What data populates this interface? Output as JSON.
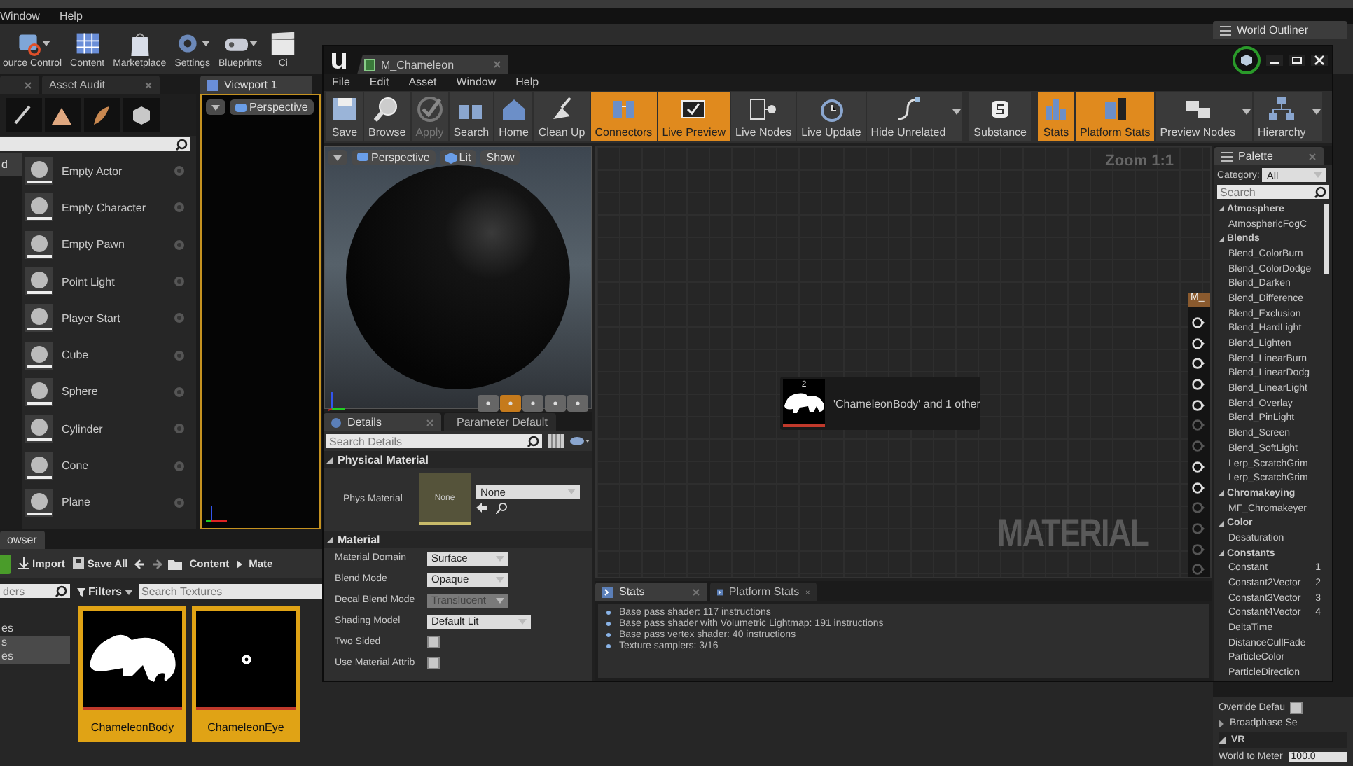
{
  "editor": {
    "menu": [
      "Window",
      "Help"
    ],
    "toolbar": [
      {
        "label": "ource Control",
        "dropdown": true
      },
      {
        "label": "Content",
        "dropdown": false
      },
      {
        "label": "Marketplace",
        "dropdown": false
      },
      {
        "label": "Settings",
        "dropdown": true
      },
      {
        "label": "Blueprints",
        "dropdown": true
      },
      {
        "label": "Ci",
        "dropdown": false
      }
    ],
    "modes": {
      "tabs": [
        {
          "label": "Asset Audit",
          "selected": false
        }
      ],
      "category": "d",
      "items": [
        "Empty Actor",
        "Empty Character",
        "Empty Pawn",
        "Point Light",
        "Player Start",
        "Cube",
        "Sphere",
        "Cylinder",
        "Cone",
        "Plane"
      ]
    },
    "viewport": {
      "tab": "Viewport 1",
      "view_mode": "Perspective"
    },
    "world_outliner": {
      "tab": "World Outliner"
    },
    "content_browser": {
      "tab": "owser",
      "actions": [
        "Import",
        "Save All"
      ],
      "path": [
        "Content",
        "Mate"
      ],
      "folder_search": {
        "placeholder": "ders"
      },
      "folders": [
        {
          "label": "es",
          "selected": false
        },
        {
          "label": "s",
          "selected": true
        },
        {
          "label": "es",
          "selected": true
        }
      ],
      "filters": "Filters",
      "asset_search": {
        "placeholder": "Search Textures"
      },
      "assets": [
        {
          "name": "ChameleonBody",
          "selected": true
        },
        {
          "name": "ChameleonEye",
          "selected": true
        }
      ]
    },
    "details": {
      "rows": [
        {
          "kind": "checkbox",
          "label": "Override Defau",
          "checked": false
        },
        {
          "kind": "group",
          "label": "Broadphase Se"
        }
      ],
      "section": "VR",
      "fields": [
        {
          "label": "World to Meter",
          "value": "100.0"
        }
      ]
    }
  },
  "material_editor": {
    "tab": "M_Chameleon",
    "menu": [
      "File",
      "Edit",
      "Asset",
      "Window",
      "Help"
    ],
    "toolbar": [
      {
        "label": "Save",
        "active": false,
        "disabled": false,
        "dropdown": false
      },
      {
        "label": "Browse",
        "active": false,
        "disabled": false,
        "dropdown": false
      },
      {
        "label": "Apply",
        "active": false,
        "disabled": true,
        "dropdown": false
      },
      {
        "label": "Search",
        "active": false,
        "disabled": false,
        "dropdown": false
      },
      {
        "label": "Home",
        "active": false,
        "disabled": false,
        "dropdown": false
      },
      {
        "label": "Clean Up",
        "active": false,
        "disabled": false,
        "dropdown": false
      },
      {
        "label": "Connectors",
        "active": true,
        "disabled": false,
        "dropdown": false
      },
      {
        "label": "Live Preview",
        "active": true,
        "disabled": false,
        "dropdown": false
      },
      {
        "label": "Live Nodes",
        "active": false,
        "disabled": false,
        "dropdown": false
      },
      {
        "label": "Live Update",
        "active": false,
        "disabled": false,
        "dropdown": false
      },
      {
        "label": "Hide Unrelated",
        "active": false,
        "disabled": false,
        "dropdown": true
      },
      {
        "label": "Substance",
        "active": false,
        "disabled": false,
        "dropdown": false
      },
      {
        "label": "Stats",
        "active": true,
        "disabled": false,
        "dropdown": false
      },
      {
        "label": "Platform Stats",
        "active": true,
        "disabled": false,
        "dropdown": false
      },
      {
        "label": "Preview Nodes",
        "active": false,
        "disabled": false,
        "dropdown": true
      },
      {
        "label": "Hierarchy",
        "active": false,
        "disabled": false,
        "dropdown": true
      }
    ],
    "viewport": {
      "buttons": [
        "Perspective",
        "Lit",
        "Show"
      ],
      "shapes": [
        {
          "selected": false
        },
        {
          "selected": true
        },
        {
          "selected": false
        },
        {
          "selected": false
        },
        {
          "selected": false
        }
      ]
    },
    "details": {
      "tabs": [
        {
          "label": "Details",
          "selected": true
        },
        {
          "label": "Parameter Default",
          "selected": false
        }
      ],
      "search": {
        "placeholder": "Search Details"
      },
      "sections": [
        {
          "title": "Physical Material",
          "expanded": true,
          "rows": [
            {
              "kind": "asset",
              "label": "Phys Material",
              "thumbnail": "None",
              "value": "None"
            }
          ]
        },
        {
          "title": "Material",
          "expanded": true,
          "rows": [
            {
              "kind": "combo",
              "label": "Material Domain",
              "value": "Surface",
              "disabled": false,
              "wide": false
            },
            {
              "kind": "combo",
              "label": "Blend Mode",
              "value": "Opaque",
              "disabled": false,
              "wide": false
            },
            {
              "kind": "combo",
              "label": "Decal Blend Mode",
              "value": "Translucent",
              "disabled": true,
              "wide": false
            },
            {
              "kind": "combo",
              "label": "Shading Model",
              "value": "Default Lit",
              "disabled": false,
              "wide": true
            },
            {
              "kind": "checkbox",
              "label": "Two Sided",
              "checked": false
            },
            {
              "kind": "checkbox",
              "label": "Use Material Attrib",
              "checked": false
            }
          ]
        }
      ]
    },
    "graph": {
      "zoom": "Zoom 1:1",
      "watermark": "MATERIAL",
      "texture_node": {
        "count": "2",
        "label": "'ChameleonBody' and 1 other"
      },
      "result_node": {
        "title": "M_",
        "pins": [
          {
            "enabled": true
          },
          {
            "enabled": true
          },
          {
            "enabled": true
          },
          {
            "enabled": true
          },
          {
            "enabled": true
          },
          {
            "enabled": false
          },
          {
            "enabled": false
          },
          {
            "enabled": true
          },
          {
            "enabled": true
          },
          {
            "enabled": false
          },
          {
            "enabled": false
          },
          {
            "enabled": false
          },
          {
            "enabled": false
          }
        ]
      }
    },
    "stats": {
      "tabs": [
        {
          "label": "Stats",
          "selected": true
        },
        {
          "label": "Platform Stats",
          "selected": false
        }
      ],
      "messages": [
        "Base pass shader: 117 instructions",
        "Base pass shader with Volumetric Lightmap: 191 instructions",
        "Base pass vertex shader: 40 instructions",
        "Texture samplers: 3/16"
      ]
    },
    "palette": {
      "tab": "Palette",
      "category_label": "Category:",
      "category": "All",
      "search": {
        "placeholder": "Search"
      },
      "groups": [
        {
          "title": "Atmosphere",
          "expanded": true,
          "children": [
            {
              "label": "AtmosphericFogC"
            }
          ]
        },
        {
          "title": "Blends",
          "expanded": true,
          "children": [
            {
              "label": "Blend_ColorBurn"
            },
            {
              "label": "Blend_ColorDodge"
            },
            {
              "label": "Blend_Darken"
            },
            {
              "label": "Blend_Difference"
            },
            {
              "label": "Blend_Exclusion"
            },
            {
              "label": "Blend_HardLight"
            },
            {
              "label": "Blend_Lighten"
            },
            {
              "label": "Blend_LinearBurn"
            },
            {
              "label": "Blend_LinearDodg"
            },
            {
              "label": "Blend_LinearLight"
            },
            {
              "label": "Blend_Overlay"
            },
            {
              "label": "Blend_PinLight"
            },
            {
              "label": "Blend_Screen"
            },
            {
              "label": "Blend_SoftLight"
            },
            {
              "label": "Lerp_ScratchGrim"
            },
            {
              "label": "Lerp_ScratchGrim"
            }
          ]
        },
        {
          "title": "Chromakeying",
          "expanded": true,
          "children": [
            {
              "label": "MF_Chromakeyer"
            }
          ]
        },
        {
          "title": "Color",
          "expanded": true,
          "children": [
            {
              "label": "Desaturation"
            }
          ]
        },
        {
          "title": "Constants",
          "expanded": true,
          "children": [
            {
              "label": "Constant",
              "shortcut": "1"
            },
            {
              "label": "Constant2Vector",
              "shortcut": "2"
            },
            {
              "label": "Constant3Vector",
              "shortcut": "3"
            },
            {
              "label": "Constant4Vector",
              "shortcut": "4"
            },
            {
              "label": "DeltaTime"
            },
            {
              "label": "DistanceCullFade"
            },
            {
              "label": "ParticleColor"
            },
            {
              "label": "ParticleDirection"
            }
          ]
        }
      ]
    }
  }
}
